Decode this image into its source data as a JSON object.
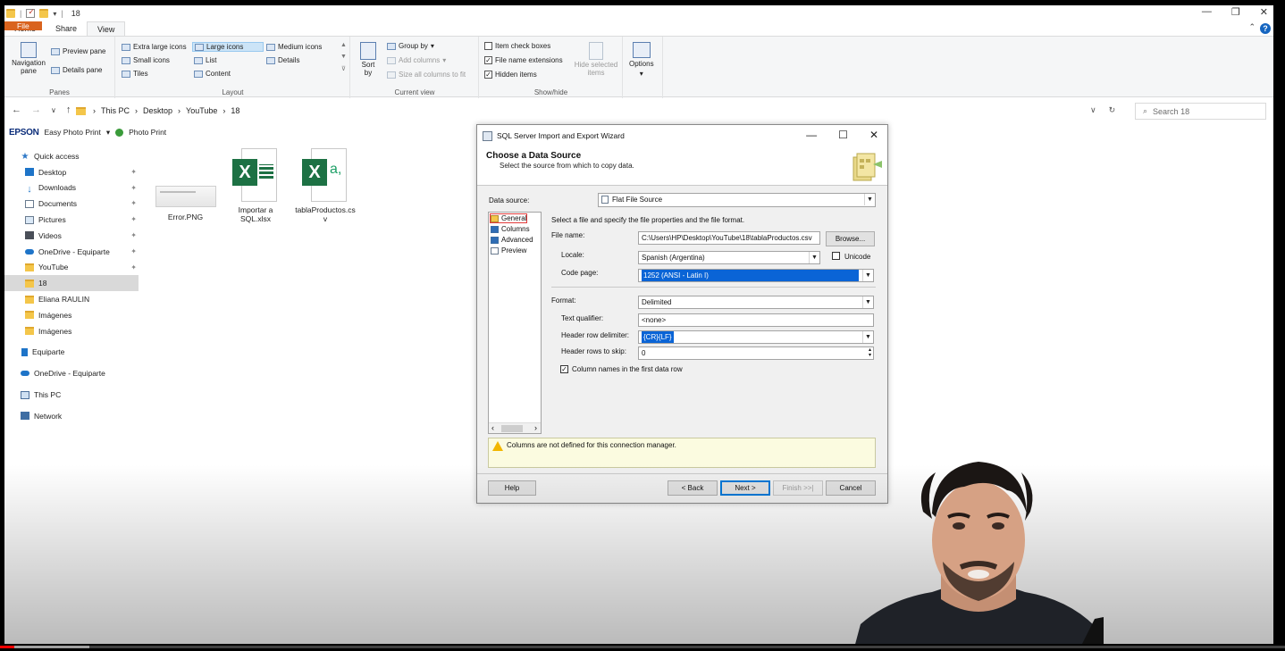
{
  "window": {
    "title": "18",
    "controls": [
      "—",
      "❐",
      "✕"
    ]
  },
  "ribbon": {
    "tabs": [
      "File",
      "Home",
      "Share",
      "View"
    ],
    "active_tab": "View",
    "panes": {
      "navigation_pane": "Navigation pane",
      "preview_pane": "Preview pane",
      "details_pane": "Details pane",
      "label": "Panes"
    },
    "layout": {
      "extra_large": "Extra large icons",
      "large": "Large icons",
      "medium": "Medium icons",
      "small": "Small icons",
      "list": "List",
      "details": "Details",
      "tiles": "Tiles",
      "content": "Content",
      "label": "Layout"
    },
    "current_view": {
      "sort_by": "Sort by",
      "group_by": "Group by",
      "add_columns": "Add columns",
      "size_all": "Size all columns to fit",
      "label": "Current view"
    },
    "show_hide": {
      "item_check_boxes": "Item check boxes",
      "file_name_extensions": "File name extensions",
      "hidden_items": "Hidden items",
      "hide_selected": "Hide selected items",
      "label": "Show/hide"
    },
    "options": "Options"
  },
  "address": {
    "path": [
      "This PC",
      "Desktop",
      "YouTube",
      "18"
    ],
    "search_placeholder": "Search 18"
  },
  "epson": {
    "brand": "EPSON",
    "easy_photo_print": "Easy Photo Print",
    "photo_print": "Photo Print"
  },
  "nav": {
    "quick_access": "Quick access",
    "items": [
      {
        "label": "Desktop",
        "icon": "desktop-icon",
        "pinned": true
      },
      {
        "label": "Downloads",
        "icon": "downloads-icon",
        "pinned": true
      },
      {
        "label": "Documents",
        "icon": "documents-icon",
        "pinned": true
      },
      {
        "label": "Pictures",
        "icon": "pictures-icon",
        "pinned": true
      },
      {
        "label": "Videos",
        "icon": "videos-icon",
        "pinned": true
      },
      {
        "label": "OneDrive - Equiparte",
        "icon": "onedrive-icon",
        "pinned": true
      },
      {
        "label": "YouTube",
        "icon": "folder-icon",
        "pinned": true
      },
      {
        "label": "18",
        "icon": "folder-icon",
        "pinned": false
      },
      {
        "label": "Eliana RAULIN",
        "icon": "folder-icon",
        "pinned": false
      },
      {
        "label": "Imágenes",
        "icon": "folder-icon",
        "pinned": false
      },
      {
        "label": "Imágenes",
        "icon": "folder-icon",
        "pinned": false
      }
    ],
    "equiparte": "Equiparte",
    "onedrive": "OneDrive - Equiparte",
    "this_pc": "This PC",
    "network": "Network"
  },
  "files": [
    {
      "name": "Error.PNG"
    },
    {
      "name": "Importar a SQL.xlsx"
    },
    {
      "name": "tablaProductos.csv"
    }
  ],
  "dialog": {
    "title": "SQL Server Import and Export Wizard",
    "heading": "Choose a Data Source",
    "subheading": "Select the source from which to copy data.",
    "data_source_label": "Data source:",
    "data_source_value": "Flat File Source",
    "tree": [
      "General",
      "Columns",
      "Advanced",
      "Preview"
    ],
    "instructions": "Select a file and specify the file properties and the file format.",
    "file_name_label": "File name:",
    "file_name_value": "C:\\Users\\HP\\Desktop\\YouTube\\18\\tablaProductos.csv",
    "browse": "Browse...",
    "locale_label": "Locale:",
    "locale_value": "Spanish (Argentina)",
    "unicode": "Unicode",
    "code_page_label": "Code page:",
    "code_page_value": "1252  (ANSI - Latin I)",
    "format_label": "Format:",
    "format_value": "Delimited",
    "text_qualifier_label": "Text qualifier:",
    "text_qualifier_value": "<none>",
    "header_row_delim_label": "Header row delimiter:",
    "header_row_delim_value": "{CR}{LF}",
    "header_rows_skip_label": "Header rows to skip:",
    "header_rows_skip_value": "0",
    "column_names_label": "Column names in the first data row",
    "warning": "Columns are not defined for this connection manager.",
    "buttons": {
      "help": "Help",
      "back": "< Back",
      "next": "Next >",
      "finish": "Finish >>|",
      "cancel": "Cancel"
    }
  },
  "video": {
    "progress": 0.011
  }
}
